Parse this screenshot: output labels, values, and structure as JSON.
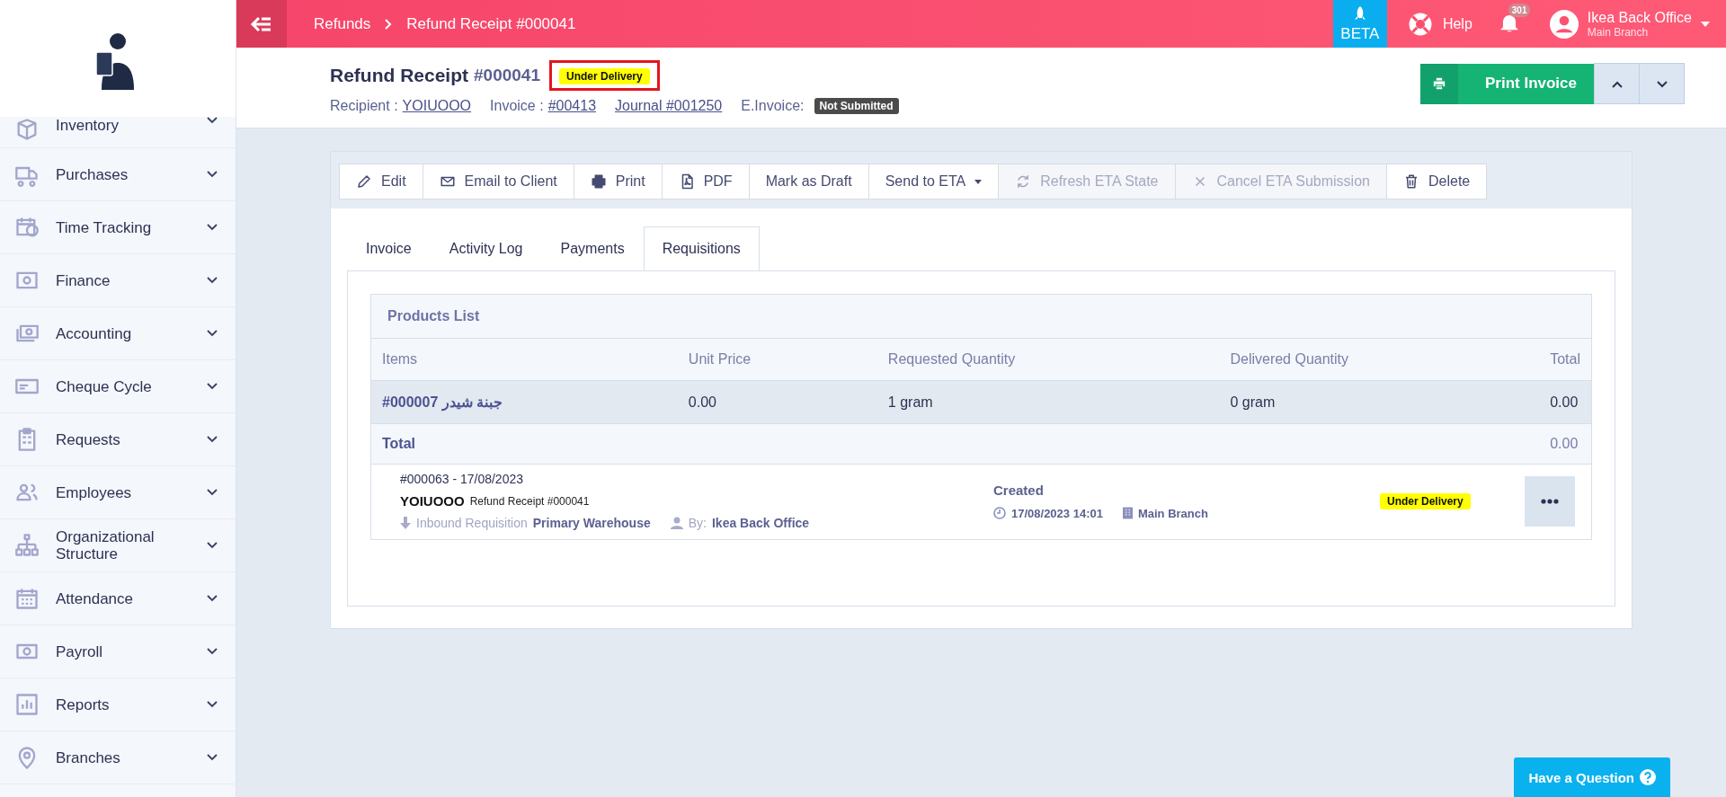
{
  "topbar": {
    "breadcrumbs": [
      {
        "label": "Refunds"
      },
      {
        "label": "Refund Receipt #000041"
      }
    ],
    "beta": "BETA",
    "help": "Help",
    "notifications": "301",
    "user": {
      "name": "Ikea Back Office",
      "branch": "Main Branch"
    }
  },
  "sidebar": {
    "items": [
      {
        "label": "Inventory",
        "kind": "box"
      },
      {
        "label": "Purchases",
        "kind": "truck"
      },
      {
        "label": "Time Tracking",
        "kind": "clock"
      },
      {
        "label": "Finance",
        "kind": "safe"
      },
      {
        "label": "Accounting",
        "kind": "money"
      },
      {
        "label": "Cheque Cycle",
        "kind": "cheque"
      },
      {
        "label": "Requests",
        "kind": "clipboard"
      },
      {
        "label": "Employees",
        "kind": "people"
      },
      {
        "label": "Organizational Structure",
        "kind": "org"
      },
      {
        "label": "Attendance",
        "kind": "calendar"
      },
      {
        "label": "Payroll",
        "kind": "cash"
      },
      {
        "label": "Reports",
        "kind": "chart"
      },
      {
        "label": "Branches",
        "kind": "pin"
      }
    ]
  },
  "header": {
    "title": "Refund Receipt",
    "number": "#000041",
    "status": "Under Delivery",
    "recipient_label": "Recipient :",
    "recipient": "YOIUOOO",
    "invoice_label": "Invoice :",
    "invoice": "#00413",
    "journal": "Journal #001250",
    "einvoice_label": "E.Invoice:",
    "einvoice_status": "Not Submitted",
    "print_button": "Print Invoice"
  },
  "toolbar": [
    {
      "label": "Edit",
      "kind": "pencil",
      "disabled": false,
      "dropdown": false
    },
    {
      "label": "Email to Client",
      "kind": "envelope",
      "disabled": false,
      "dropdown": false
    },
    {
      "label": "Print",
      "kind": "printer",
      "disabled": false,
      "dropdown": false
    },
    {
      "label": "PDF",
      "kind": "pdf",
      "disabled": false,
      "dropdown": false
    },
    {
      "label": "Mark as Draft",
      "kind": "none",
      "disabled": false,
      "dropdown": false
    },
    {
      "label": "Send to ETA",
      "kind": "none",
      "disabled": false,
      "dropdown": true
    },
    {
      "label": "Refresh ETA State",
      "kind": "refresh",
      "disabled": true,
      "dropdown": false
    },
    {
      "label": "Cancel ETA Submission",
      "kind": "cross",
      "disabled": true,
      "dropdown": false
    },
    {
      "label": "Delete",
      "kind": "trash",
      "disabled": false,
      "dropdown": false
    }
  ],
  "tabs": [
    {
      "label": "Invoice",
      "selected": false
    },
    {
      "label": "Activity Log",
      "selected": false
    },
    {
      "label": "Payments",
      "selected": false
    },
    {
      "label": "Requisitions",
      "selected": true
    }
  ],
  "products": {
    "title": "Products List",
    "columns": [
      "Items",
      "Unit Price",
      "Requested Quantity",
      "Delivered Quantity",
      "Total"
    ],
    "rows": [
      {
        "item": "#000007 جبنة شيدر",
        "unit_price": "0.00",
        "requested": "1 gram",
        "delivered": "0 gram",
        "total": "0.00"
      }
    ],
    "total_label": "Total",
    "total_value": "0.00"
  },
  "requisition": {
    "number_date": "#000063 - 17/08/2023",
    "client": "YOIUOOO",
    "reference": "Refund Receipt #000041",
    "type": "Inbound Requisition",
    "warehouse": "Primary Warehouse",
    "by_label": "By:",
    "by": "Ikea Back Office",
    "state": "Created",
    "datetime": "17/08/2023 14:01",
    "branch": "Main Branch",
    "status": "Under Delivery"
  },
  "help_button": "Have a Question"
}
